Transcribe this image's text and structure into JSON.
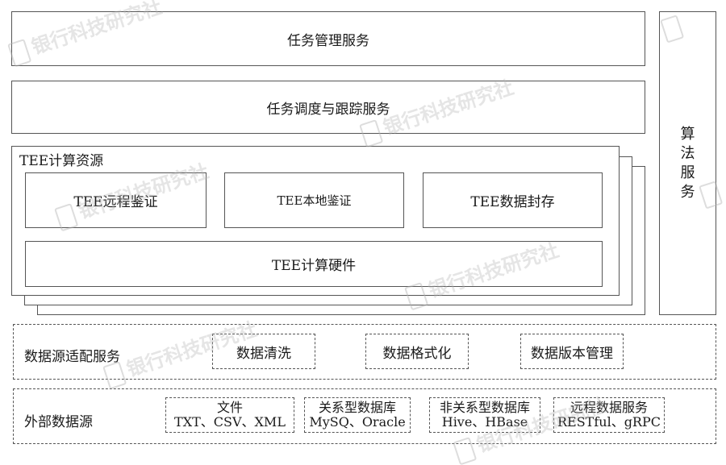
{
  "diagram": {
    "task_management": "任务管理服务",
    "task_scheduling": "任务调度与跟踪服务",
    "algorithm_service_chars": [
      "算",
      "法",
      "服",
      "务"
    ],
    "tee_resources": {
      "title": "TEE计算资源",
      "remote_attestation": "TEE远程鉴证",
      "local_attestation": "TEE本地鉴证",
      "data_sealing": "TEE数据封存",
      "hardware": "TEE计算硬件"
    },
    "adapter": {
      "title": "数据源适配服务",
      "cleaning": "数据清洗",
      "formatting": "数据格式化",
      "versioning": "数据版本管理"
    },
    "external": {
      "title": "外部数据源",
      "items": [
        {
          "line1": "文件",
          "line2": "TXT、CSV、XML"
        },
        {
          "line1": "关系型数据库",
          "line2": "MySQ、Oracle"
        },
        {
          "line1": "非关系型数据库",
          "line2": "Hive、HBase"
        },
        {
          "line1": "远程数据服务",
          "line2": "RESTful、gRPC"
        }
      ]
    }
  },
  "watermark": "银行科技研究社"
}
